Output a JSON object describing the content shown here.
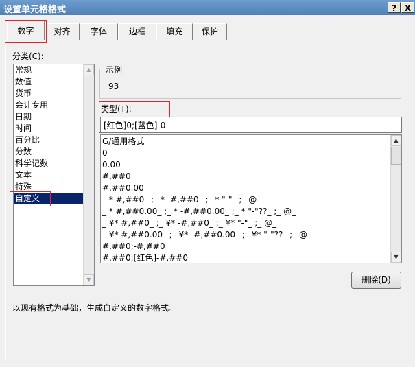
{
  "window": {
    "title": "设置单元格格式",
    "help_label": "?",
    "close_label": "X"
  },
  "tabs": [
    "数字",
    "对齐",
    "字体",
    "边框",
    "填充",
    "保护"
  ],
  "category": {
    "label": "分类(C):",
    "items": [
      "常规",
      "数值",
      "货币",
      "会计专用",
      "日期",
      "时间",
      "百分比",
      "分数",
      "科学记数",
      "文本",
      "特殊",
      "自定义"
    ],
    "selected": "自定义"
  },
  "sample": {
    "label": "示例",
    "value": "93"
  },
  "type": {
    "label": "类型(T):",
    "value": "[红色]0;[蓝色]-0",
    "formats": [
      "G/通用格式",
      "0",
      "0.00",
      "#,##0",
      "#,##0.00",
      "_ * #,##0_ ;_ * -#,##0_ ;_ * \"-\"_ ;_ @_",
      "_ * #,##0.00_ ;_ * -#,##0.00_ ;_ * \"-\"??_ ;_ @_",
      "_ ¥* #,##0_ ;_ ¥* -#,##0_ ;_ ¥* \"-\"_ ;_ @_",
      "_ ¥* #,##0.00_ ;_ ¥* -#,##0.00_ ;_ ¥* \"-\"??_ ;_ @_",
      "#,##0;-#,##0",
      "#,##0;[红色]-#,##0"
    ]
  },
  "delete_button": "删除(D)",
  "description": "以现有格式为基础，生成自定义的数字格式。",
  "colors": {
    "highlight": "#e0262c",
    "selection": "#0a246a",
    "title_bar": "#4f80b8"
  }
}
